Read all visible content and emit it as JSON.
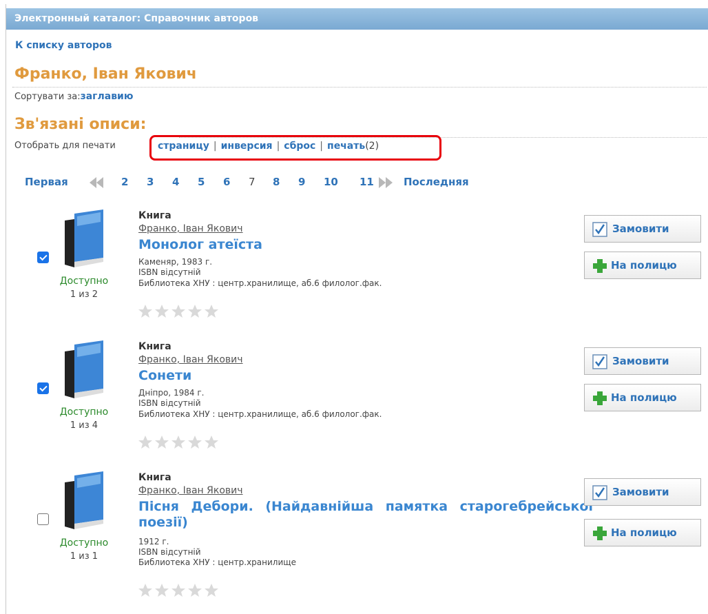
{
  "header": {
    "title": "Электронный каталог: Справочник авторов"
  },
  "nav": {
    "back_link": "К списку авторов"
  },
  "author": {
    "name": "Франко, Іван Якович"
  },
  "sort": {
    "label": "Сортувати за:",
    "link": "заглавию"
  },
  "related": {
    "title": "Зв'язані описи:"
  },
  "print": {
    "label": "Отобрать для печати",
    "page": "страницу",
    "inverse": "инверсия",
    "reset": "сброс",
    "print": "печать",
    "count": "(2)",
    "sep": "|"
  },
  "pager": {
    "first": "Первая",
    "last": "Последняя",
    "pages": [
      "2",
      "3",
      "4",
      "5",
      "6",
      "7",
      "8",
      "9",
      "10",
      "11"
    ],
    "current": "7"
  },
  "records": [
    {
      "type": "Книга",
      "author": "Франко, Іван Якович",
      "title": "Монолог атеїста",
      "publisher": "Каменяр, 1983 г.",
      "isbn": "ISBN відсутній",
      "location": "Библиотека ХНУ : центр.хранилище, аб.6 филолог.фак.",
      "status": "Доступно",
      "count": "1 из 2",
      "checked": true,
      "rating": 0,
      "order_btn": "Замовити",
      "shelf_btn": "На полицю"
    },
    {
      "type": "Книга",
      "author": "Франко, Іван Якович",
      "title": "Сонети",
      "publisher": "Дніпро, 1984 г.",
      "isbn": "ISBN відсутній",
      "location": "Библиотека ХНУ : центр.хранилище, аб.6 филолог.фак.",
      "status": "Доступно",
      "count": "1 из 4",
      "checked": true,
      "rating": 0,
      "order_btn": "Замовити",
      "shelf_btn": "На полицю"
    },
    {
      "type": "Книга",
      "author": "Франко, Іван Якович",
      "title": "Пісня Дебори. (Найдавнійша памятка старогебрейської поезії)",
      "publisher": "1912 г.",
      "isbn": "ISBN відсутній",
      "location": "Библиотека ХНУ : центр.хранилище",
      "status": "Доступно",
      "count": "1 из 1",
      "checked": false,
      "rating": 0,
      "order_btn": "Замовити",
      "shelf_btn": "На полицю"
    }
  ],
  "colors": {
    "accent": "#2f73b8",
    "heading": "#e09a3e",
    "available": "#2b8a2b",
    "highlight": "#e8000a"
  }
}
